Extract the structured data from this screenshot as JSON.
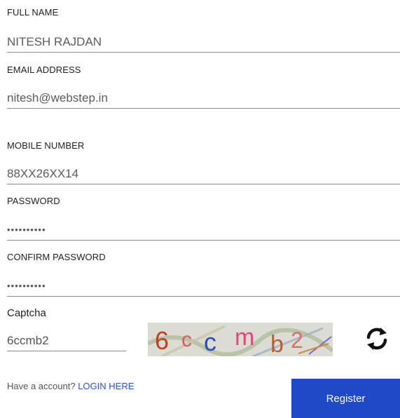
{
  "form": {
    "full_name_label": "FULL NAME",
    "full_name_value": "NITESH RAJDAN",
    "email_label": "EMAIL ADDRESS",
    "email_value": "nitesh@webstep.in",
    "mobile_label": "MOBILE NUMBER",
    "mobile_value": "88XX26XX14",
    "password_label": "PASSWORD",
    "password_value": "••••••••••",
    "confirm_password_label": "CONFIRM PASSWORD",
    "confirm_password_value": "••••••••••",
    "captcha_label": "Captcha",
    "captcha_value": "6ccmb2",
    "captcha_image_text": "6ccmb2"
  },
  "footer": {
    "have_account_text": "Have a account?",
    "login_link": "LOGIN HERE",
    "register_label": "Register"
  },
  "colors": {
    "accent": "#2049c7",
    "link": "#2a55c9"
  },
  "icons": {
    "refresh": "refresh-icon"
  }
}
